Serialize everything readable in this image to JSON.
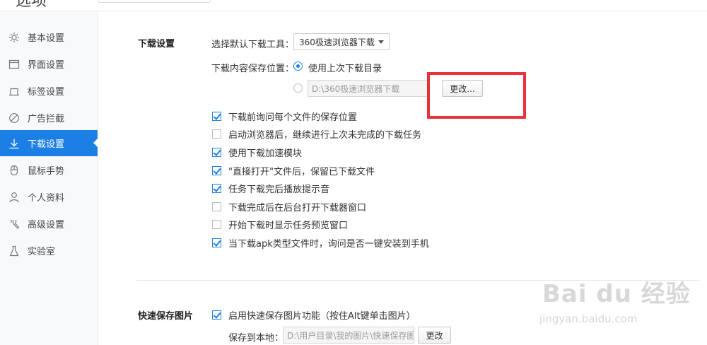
{
  "window": {
    "title": "选项"
  },
  "sidebar": {
    "items": [
      {
        "label": "基本设置",
        "icon": "gear-icon"
      },
      {
        "label": "界面设置",
        "icon": "window-icon"
      },
      {
        "label": "标签设置",
        "icon": "tab-icon"
      },
      {
        "label": "广告拦截",
        "icon": "block-icon"
      },
      {
        "label": "下载设置",
        "icon": "download-icon",
        "active": true
      },
      {
        "label": "鼠标手势",
        "icon": "mouse-icon"
      },
      {
        "label": "个人资料",
        "icon": "user-icon"
      },
      {
        "label": "高级设置",
        "icon": "wrench-icon"
      },
      {
        "label": "实验室",
        "icon": "flask-icon"
      }
    ]
  },
  "download": {
    "section_title": "下载设置",
    "tool_label": "选择默认下载工具：",
    "tool_value": "360极速浏览器下载",
    "save_location_label": "下载内容保存位置：",
    "radio_last_dir": "使用上次下载目录",
    "path_value": "D:\\360极速浏览器下载",
    "change_button": "更改...",
    "options": [
      {
        "label": "下载前询问每个文件的保存位置",
        "checked": true
      },
      {
        "label": "启动浏览器后，继续进行上次未完成的下载任务",
        "checked": false
      },
      {
        "label": "使用下载加速模块",
        "checked": true
      },
      {
        "label": "\"直接打开\"文件后，保留已下载文件",
        "checked": true
      },
      {
        "label": "任务下载完后播放提示音",
        "checked": true
      },
      {
        "label": "下载完成后在后台打开下载器窗口",
        "checked": false
      },
      {
        "label": "开始下载时显示任务预览窗口",
        "checked": false
      },
      {
        "label": "当下载apk类型文件时，询问是否一键安装到手机",
        "checked": true
      }
    ]
  },
  "quick_save": {
    "section_title": "快速保存图片",
    "enable_label": "启用快速保存图片功能（按住Alt键单击图片）",
    "enable_checked": true,
    "save_local_label": "保存到本地：",
    "path_value": "D:\\用户目录\\我的图片\\快速保存图",
    "change_button": "更改"
  },
  "watermark": {
    "main": "Bai du 经验",
    "sub": "jingyan.baidu.com"
  },
  "colors": {
    "accent": "#1b7fe4",
    "annotation": "#e8323a"
  }
}
